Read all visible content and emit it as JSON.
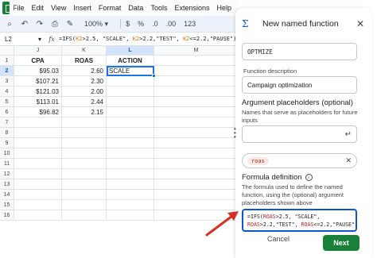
{
  "menu": {
    "items": [
      "File",
      "Edit",
      "View",
      "Insert",
      "Format",
      "Data",
      "Tools",
      "Extensions",
      "Help"
    ]
  },
  "toolbar": {
    "zoom": "100%",
    "currency": "$",
    "percent": "%",
    "dec_less": ".0",
    "dec_more": ".00",
    "number_format": "123"
  },
  "formula_bar": {
    "cell_ref": "L2",
    "formula_parts": [
      "=IFS(",
      "K2",
      ">2.5, \"SCALE\", ",
      "K2",
      ">2.2,\"TEST\", ",
      "K2",
      "<=2.2,\"PAUSE\")"
    ]
  },
  "grid": {
    "columns": [
      "J",
      "K",
      "L",
      "M"
    ],
    "rows": [
      "1",
      "2",
      "3",
      "4",
      "5",
      "6",
      "7",
      "8",
      "9",
      "10",
      "11",
      "12",
      "13",
      "14",
      "15",
      "16"
    ],
    "cells": [
      [
        "CPA",
        "ROAS",
        "ACTION",
        ""
      ],
      [
        "$95.03",
        "2.60",
        "SCALE",
        ""
      ],
      [
        "$107.21",
        "2.30",
        "",
        ""
      ],
      [
        "$121.03",
        "2.00",
        "",
        ""
      ],
      [
        "$113.01",
        "2.44",
        "",
        ""
      ],
      [
        "$96.82",
        "2.15",
        "",
        ""
      ]
    ],
    "active_cell": "L2"
  },
  "panel": {
    "title": "New named function",
    "function_name": "OPTMIZE",
    "description_label": "Function description",
    "description_value": "Campaign optimization",
    "placeholders_title": "Argument placeholders (optional)",
    "placeholders_desc": "Names that serve as placeholders for future inputs",
    "placeholder_chip": "roas",
    "definition_title": "Formula definition",
    "definition_desc": "The formula used to define the named function, using the (optional) argument placeholders shown above",
    "definition_line1_parts": [
      "=IFS(",
      "ROAS",
      ">2.5, \"SCALE\","
    ],
    "definition_line2_parts": [
      "ROAS",
      ">2.2,\"TEST\", ",
      "ROAS",
      "<=2.2,\"PAUSE\")"
    ],
    "cancel_label": "Cancel",
    "next_label": "Next"
  },
  "colors": {
    "accent_blue": "#0b57d0",
    "next_green": "#188038",
    "arrow_red": "#d93025",
    "ref_orange": "#e37400"
  }
}
